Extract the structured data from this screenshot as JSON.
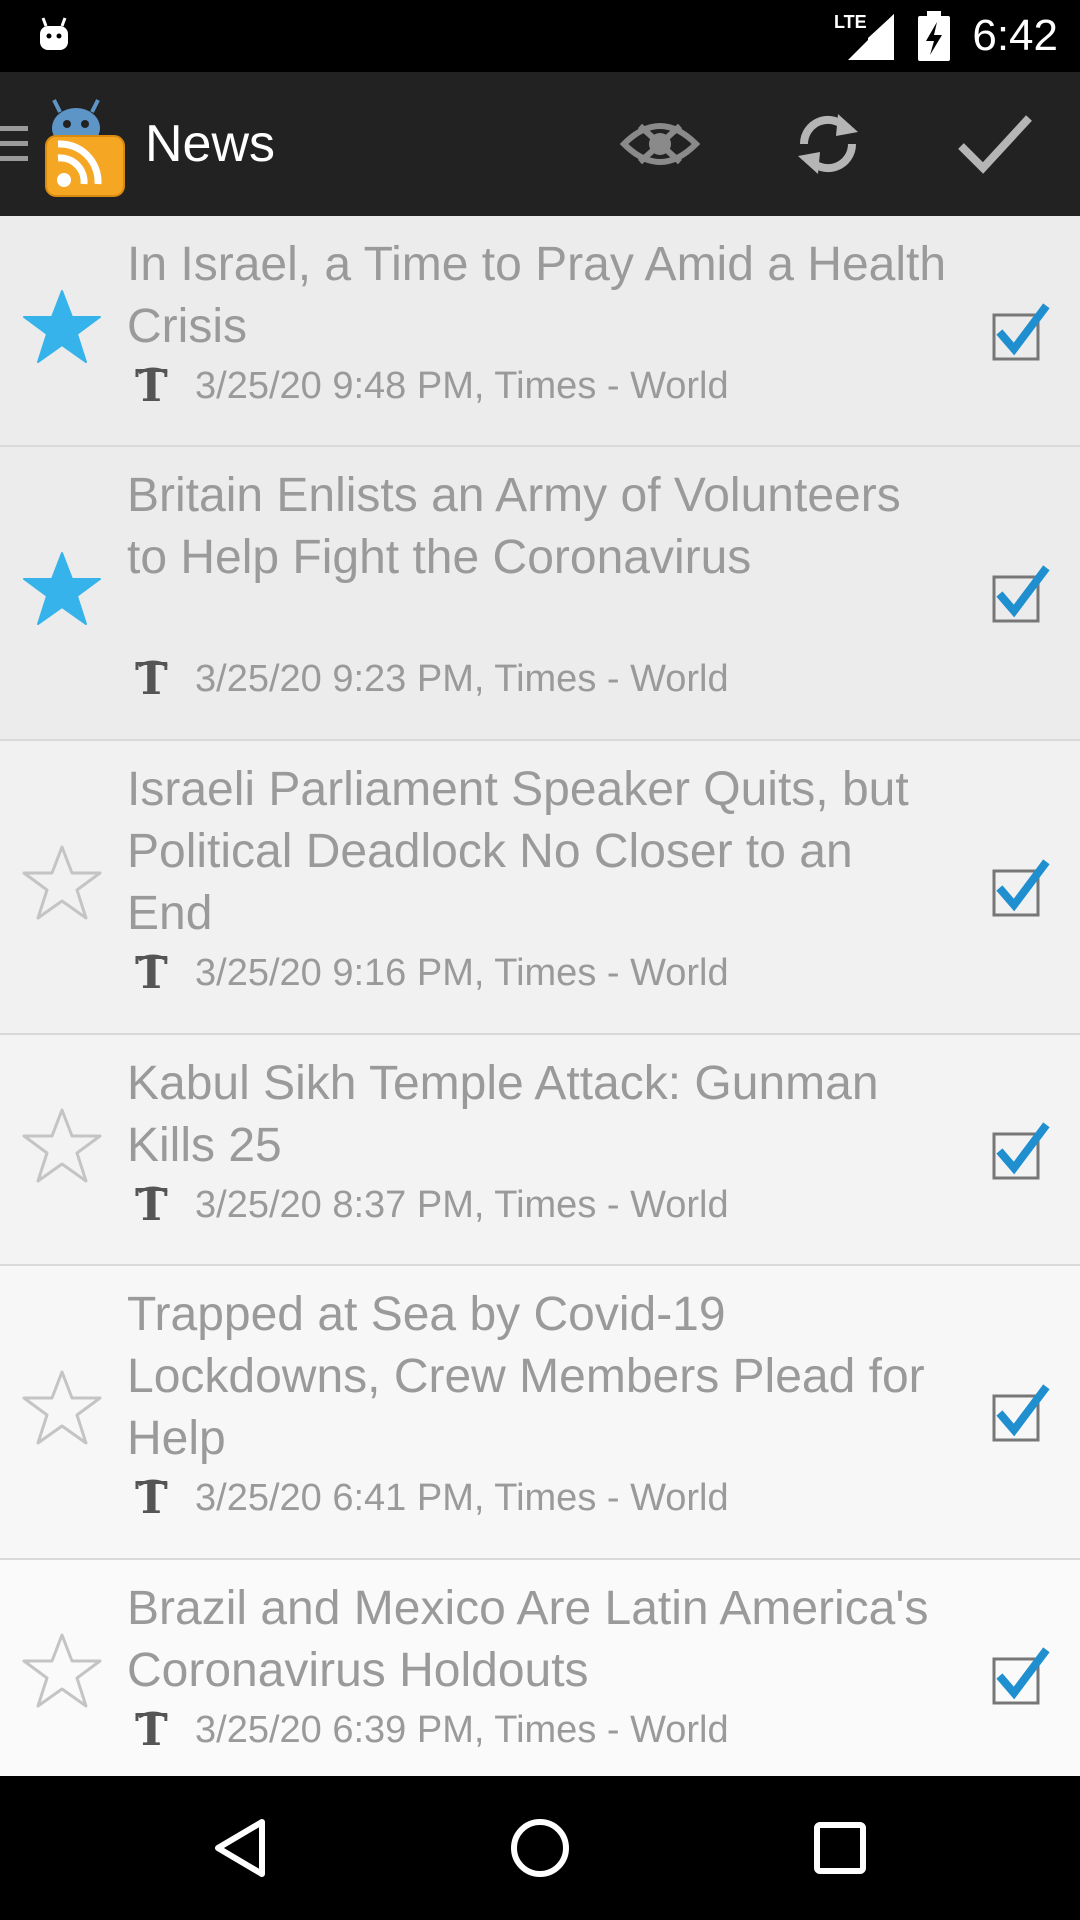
{
  "status_bar": {
    "network": "LTE",
    "time": "6:42"
  },
  "action_bar": {
    "title": "News",
    "icons": [
      "menu-icon",
      "app-logo",
      "hide-read-icon",
      "refresh-icon",
      "mark-all-read-icon"
    ]
  },
  "colors": {
    "star_active": "#35b3ea",
    "check_blue": "#1f8fd0",
    "action_bar": "#222222",
    "text_read": "#9a9a9a"
  },
  "items": [
    {
      "headline": "In Israel, a Time to Pray Amid a Health Crisis",
      "meta": "3/25/20 9:48 PM, Times - World",
      "starred": true,
      "checked": true
    },
    {
      "headline": "Britain Enlists an Army of Volunteers to Help Fight the Coronavirus",
      "meta": "3/25/20 9:23 PM, Times - World",
      "starred": true,
      "checked": true
    },
    {
      "headline": "Israeli Parliament Speaker Quits, but Political Deadlock No Closer to an End",
      "meta": "3/25/20 9:16 PM, Times - World",
      "starred": false,
      "checked": true
    },
    {
      "headline": "Kabul Sikh Temple Attack: Gunman Kills 25",
      "meta": "3/25/20 8:37 PM, Times - World",
      "starred": false,
      "checked": true
    },
    {
      "headline": "Trapped at Sea by Covid-19 Lockdowns, Crew Members Plead for Help",
      "meta": "3/25/20 6:41 PM, Times - World",
      "starred": false,
      "checked": true
    },
    {
      "headline": "Brazil and Mexico Are Latin America's Coronavirus Holdouts",
      "meta": "3/25/20 6:39 PM, Times - World",
      "starred": false,
      "checked": true
    }
  ],
  "nav_bar": {
    "icons": [
      "back-icon",
      "home-icon",
      "recents-icon"
    ]
  }
}
